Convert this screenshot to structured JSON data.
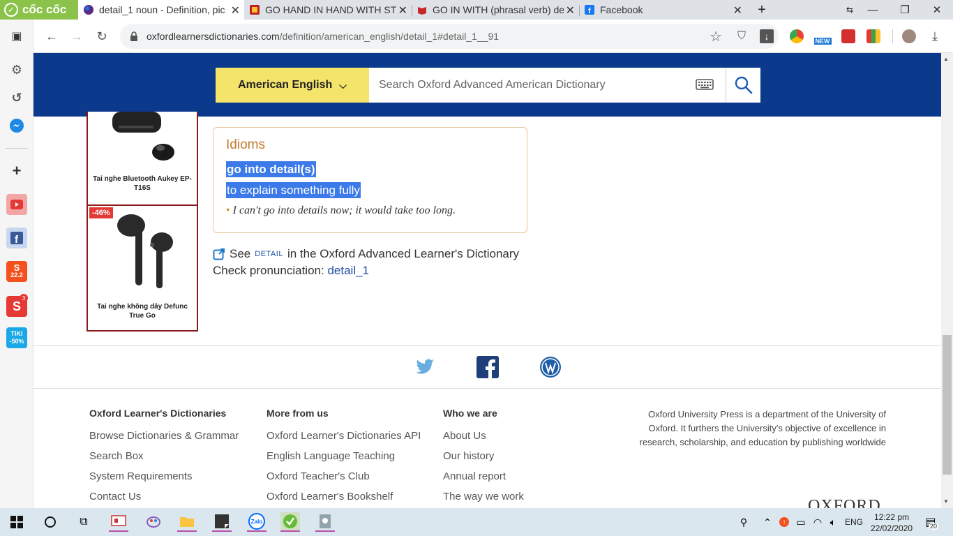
{
  "browser": {
    "brand": "cốc cốc",
    "tabs": [
      {
        "title": "detail_1 noun - Definition, pic",
        "active": true
      },
      {
        "title": "GO HAND IN HAND WITH ST",
        "active": false
      },
      {
        "title": "GO IN WITH (phrasal verb) de",
        "active": false
      },
      {
        "title": "Facebook",
        "active": false
      }
    ],
    "url_domain": "oxfordlearnersdictionaries.com",
    "url_path": "/definition/american_english/detail_1#detail_1__91",
    "new_badge": "NEW"
  },
  "sidebar": {
    "shopee_badge": "22.2",
    "notif_count": "3",
    "tiki_label": "TIKI",
    "tiki_discount": "-50%"
  },
  "header": {
    "language": "American English",
    "search_placeholder": "Search Oxford Advanced American Dictionary"
  },
  "ads": [
    {
      "caption": "Tai nghe Bluetooth Aukey EP-T16S",
      "badge": ""
    },
    {
      "caption": "Tai nghe không dây Defunc True Go",
      "badge": "-46%"
    }
  ],
  "idioms": {
    "heading": "Idioms",
    "idiom": "go into detail(s)",
    "definition": "to explain something fully",
    "example": "I can't go into details now; it would take too long."
  },
  "see_also": {
    "prefix": "See",
    "word": "DETAIL",
    "suffix": "in the Oxford Advanced Learner's Dictionary"
  },
  "pronunciation": {
    "label": "Check pronunciation:",
    "link": "detail_1"
  },
  "footer": {
    "col1": {
      "heading": "Oxford Learner's Dictionaries",
      "links": [
        "Browse Dictionaries & Grammar",
        "Search Box",
        "System Requirements",
        "Contact Us"
      ]
    },
    "col2": {
      "heading": "More from us",
      "links": [
        "Oxford Learner's Dictionaries API",
        "English Language Teaching",
        "Oxford Teacher's Club",
        "Oxford Learner's Bookshelf"
      ]
    },
    "col3": {
      "heading": "Who we are",
      "links": [
        "About Us",
        "Our history",
        "Annual report",
        "The way we work"
      ]
    },
    "about": "Oxford University Press is a department of the University of Oxford. It furthers the University's objective of excellence in research, scholarship, and education by publishing worldwide",
    "logo": "OXFORD"
  },
  "taskbar": {
    "language": "ENG",
    "time": "12:22 pm",
    "date": "22/02/2020",
    "notifications": "20",
    "zalo": "Zalo"
  },
  "colors": {
    "header_blue": "#0b3a8c",
    "lang_yellow": "#f5e46c",
    "highlight": "#3b7ae8",
    "idiom_orange": "#c17a2b"
  }
}
